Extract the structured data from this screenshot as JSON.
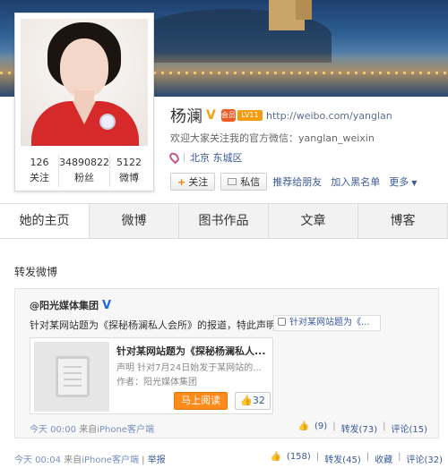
{
  "profile": {
    "name": "杨澜",
    "badges": {
      "v": "V",
      "vip": "会员",
      "level": "LV11"
    },
    "url": "http://weibo.com/yanglan",
    "wechat": "欢迎大家关注我的官方微信：yanglan_weixin",
    "location": "北京 东城区",
    "stats": [
      {
        "num": "126",
        "label": "关注"
      },
      {
        "num": "34890822",
        "label": "粉丝"
      },
      {
        "num": "5122",
        "label": "微博"
      }
    ],
    "actions": {
      "follow": "关注",
      "message": "私信",
      "recommend": "推荐给朋友",
      "blacklist": "加入黑名单",
      "more": "更多"
    }
  },
  "tabs": [
    "她的主页",
    "微博",
    "图书作品",
    "文章",
    "博客"
  ],
  "section_title": "转发微博",
  "repost": {
    "source": "@阳光媒体集团",
    "text": "针对某网站题为《探秘杨澜私人会所》的报道，特此声明:",
    "url_chip": "针对某网站题为《...",
    "article": {
      "title": "针对某网站题为《探秘杨澜私人...",
      "desc": "声明 针对7月24日始发于某网站的...",
      "author": "作者：阳光媒体集团",
      "read": "马上阅读",
      "likes": "32"
    },
    "meta": {
      "time": "今天 00:00",
      "via": "来自",
      "client": "iPhone客户端"
    },
    "stats": {
      "likes": "(9)",
      "repost": "转发(73)",
      "comment": "评论(15)"
    }
  },
  "post_meta": {
    "time": "今天 00:04",
    "via": "来自",
    "client": "iPhone客户端",
    "report": "举报"
  },
  "post_stats": {
    "likes": "(158)",
    "repost": "转发(45)",
    "fav": "收藏",
    "comment": "评论(32)"
  }
}
